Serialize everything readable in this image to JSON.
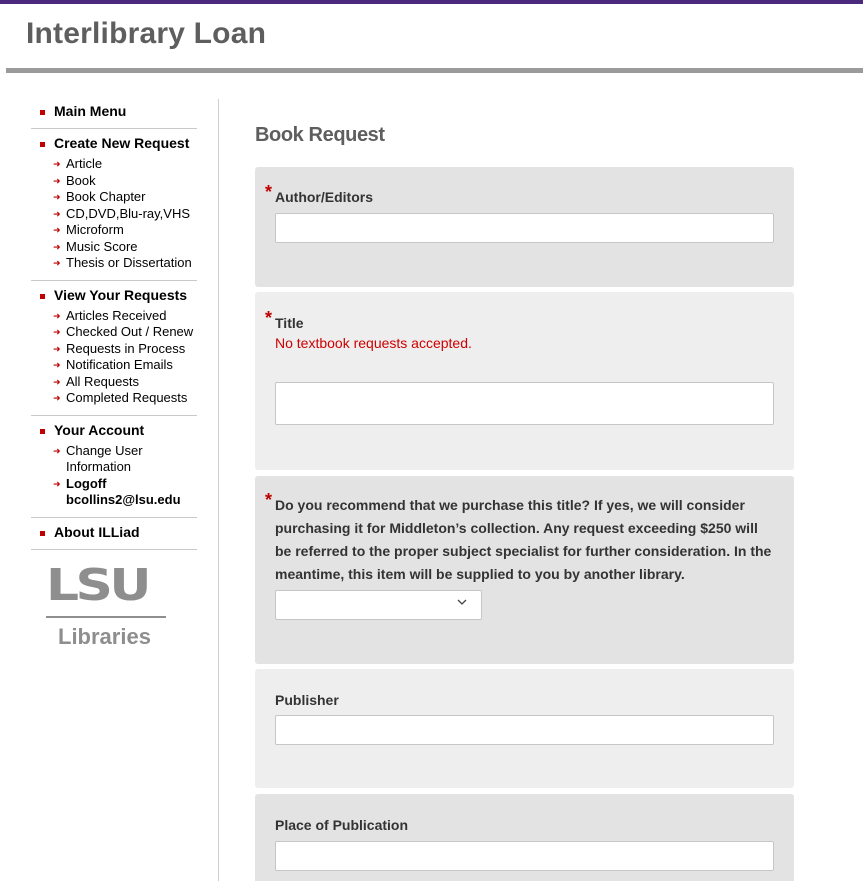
{
  "header": {
    "site_title": "Interlibrary Loan",
    "accent_color": "#4b2a7d"
  },
  "sidebar": {
    "main_menu": "Main Menu",
    "create_new_request": {
      "title": "Create New Request",
      "items": [
        "Article",
        "Book",
        "Book Chapter",
        "CD,DVD,Blu-ray,VHS",
        "Microform",
        "Music Score",
        "Thesis or Dissertation"
      ]
    },
    "view_your_requests": {
      "title": "View Your Requests",
      "items": [
        "Articles Received",
        "Checked Out / Renew",
        "Requests in Process",
        "Notification Emails",
        "All Requests",
        "Completed Requests"
      ]
    },
    "your_account": {
      "title": "Your Account",
      "change_user_info": "Change User Information",
      "logoff": "Logoff",
      "user_email": "bcollins2@lsu.edu"
    },
    "about": "About ILLiad",
    "logo": {
      "wordmark": "LSU",
      "sub": "Libraries"
    }
  },
  "main": {
    "heading": "Book Request",
    "required_marker": "*",
    "fields": {
      "author": {
        "label": "Author/Editors",
        "value": ""
      },
      "title": {
        "label": "Title",
        "note": "No textbook requests accepted.",
        "value": ""
      },
      "purchase": {
        "label": "Do you recommend that we purchase this title? If yes, we will consider purchasing it for Middleton’s collection. Any request exceeding $250 will be referred to the proper subject specialist for further consideration. In the meantime, this item will be supplied to you by another library.",
        "selected": ""
      },
      "publisher": {
        "label": "Publisher",
        "value": ""
      },
      "place_of_publication": {
        "label": "Place of Publication",
        "value": ""
      }
    }
  }
}
